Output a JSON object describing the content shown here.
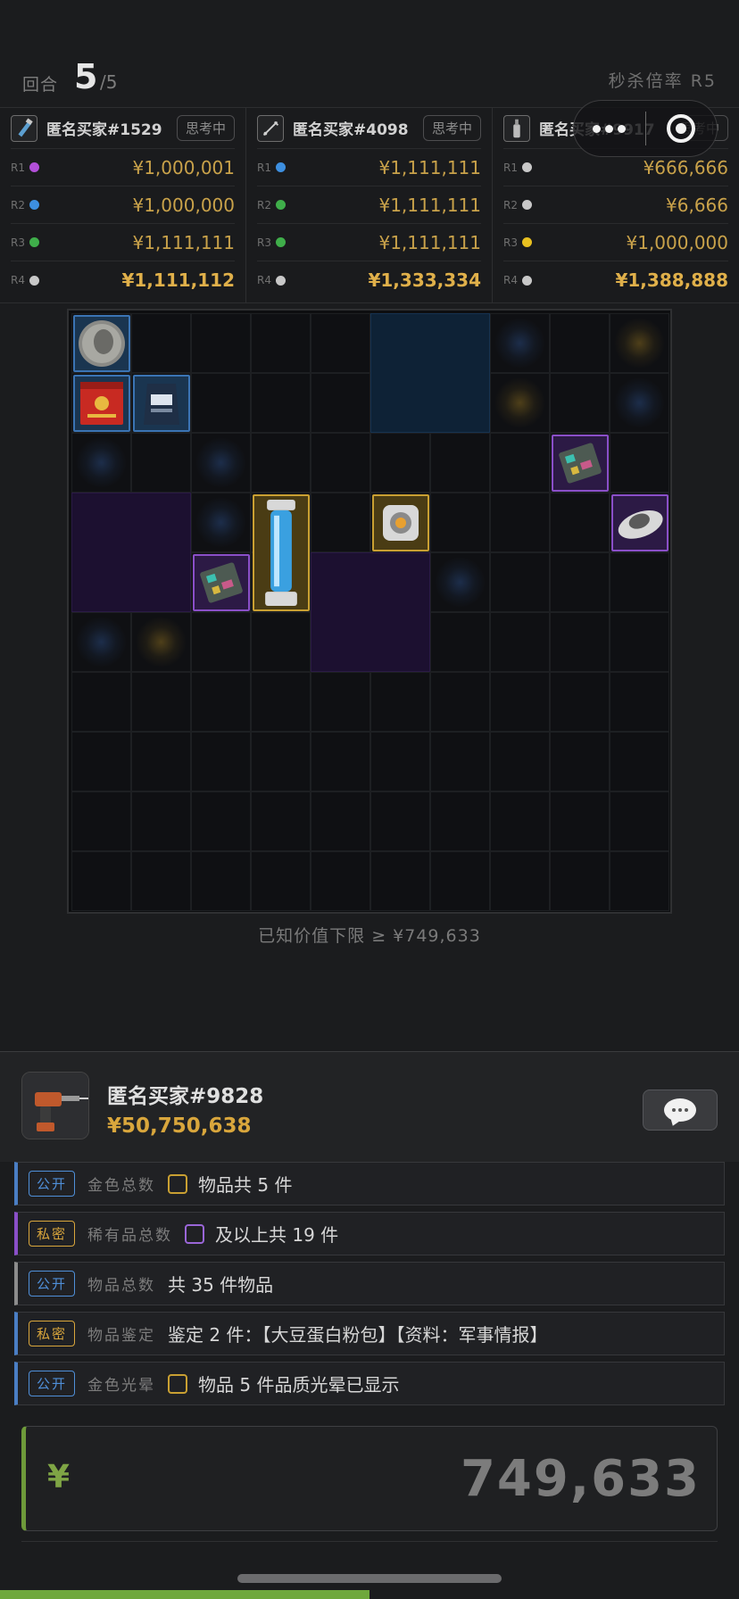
{
  "round": {
    "label": "回合",
    "current": "5",
    "total": "/5"
  },
  "kill_rate": {
    "label": "秒杀倍率 R5"
  },
  "bidders": [
    {
      "name": "匿名买家#1529",
      "status": "思考中",
      "icon": "flashlight-icon",
      "bids": [
        {
          "r": "R1",
          "dot": "#b24fd8",
          "amount": "¥1,000,001"
        },
        {
          "r": "R2",
          "dot": "#3d8fe0",
          "amount": "¥1,000,000"
        },
        {
          "r": "R3",
          "dot": "#3fae4a",
          "amount": "¥1,111,111"
        },
        {
          "r": "R4",
          "dot": "#c8c8c8",
          "amount": "¥1,111,112"
        }
      ]
    },
    {
      "name": "匿名买家#4098",
      "status": "思考中",
      "icon": "tool-icon",
      "bids": [
        {
          "r": "R1",
          "dot": "#3d8fe0",
          "amount": "¥1,111,111"
        },
        {
          "r": "R2",
          "dot": "#3fae4a",
          "amount": "¥1,111,111"
        },
        {
          "r": "R3",
          "dot": "#3fae4a",
          "amount": "¥1,111,111"
        },
        {
          "r": "R4",
          "dot": "#c8c8c8",
          "amount": "¥1,333,334"
        }
      ]
    },
    {
      "name": "匿名买家#9917",
      "status": "思考中",
      "icon": "bottle-icon",
      "bids": [
        {
          "r": "R1",
          "dot": "#c8c8c8",
          "amount": "¥666,666"
        },
        {
          "r": "R2",
          "dot": "#c8c8c8",
          "amount": "¥6,666"
        },
        {
          "r": "R3",
          "dot": "#e8c020",
          "amount": "¥1,000,000"
        },
        {
          "r": "R4",
          "dot": "#c8c8c8",
          "amount": "¥1,388,888"
        }
      ]
    }
  ],
  "grid": {
    "rows": 10,
    "cols": 10,
    "glows": [
      {
        "c": 7,
        "r": 0,
        "color": "blue"
      },
      {
        "c": 9,
        "r": 0,
        "color": "gold"
      },
      {
        "c": 7,
        "r": 1,
        "color": "gold"
      },
      {
        "c": 9,
        "r": 1,
        "color": "blue"
      },
      {
        "c": 0,
        "r": 2,
        "color": "blue"
      },
      {
        "c": 2,
        "r": 2,
        "color": "blue"
      },
      {
        "c": 2,
        "r": 3,
        "color": "blue"
      },
      {
        "c": 6,
        "r": 4,
        "color": "blue"
      },
      {
        "c": 0,
        "r": 5,
        "color": "blue"
      },
      {
        "c": 1,
        "r": 5,
        "color": "gold"
      }
    ],
    "zones": [
      {
        "c": 5,
        "r": 0,
        "w": 2,
        "h": 2,
        "color": "blue"
      },
      {
        "c": 0,
        "r": 3,
        "w": 2,
        "h": 2,
        "color": "purple"
      },
      {
        "c": 4,
        "r": 4,
        "w": 2,
        "h": 2,
        "color": "purple"
      }
    ],
    "items": [
      {
        "name": "coin-item",
        "icon": "coin-icon",
        "c": 0,
        "r": 0,
        "w": 1,
        "h": 1,
        "rarity": "blue"
      },
      {
        "name": "tea-tin-item",
        "icon": "tea-tin-icon",
        "c": 0,
        "r": 1,
        "w": 1,
        "h": 1,
        "rarity": "blue"
      },
      {
        "name": "coffee-bag-item",
        "icon": "coffee-bag-icon",
        "c": 1,
        "r": 1,
        "w": 1,
        "h": 1,
        "rarity": "blue"
      },
      {
        "name": "circuit-board-item",
        "icon": "circuit-board-icon",
        "c": 8,
        "r": 2,
        "w": 1,
        "h": 1,
        "rarity": "purple"
      },
      {
        "name": "liquid-tube-item",
        "icon": "liquid-tube-icon",
        "c": 3,
        "r": 3,
        "w": 1,
        "h": 2,
        "rarity": "gold"
      },
      {
        "name": "cube-item",
        "icon": "cube-icon",
        "c": 5,
        "r": 3,
        "w": 1,
        "h": 1,
        "rarity": "gold"
      },
      {
        "name": "ufo-item",
        "icon": "ufo-icon",
        "c": 9,
        "r": 3,
        "w": 1,
        "h": 1,
        "rarity": "purple"
      },
      {
        "name": "circuit-board-item-2",
        "icon": "circuit-board-icon",
        "c": 2,
        "r": 4,
        "w": 1,
        "h": 1,
        "rarity": "purple"
      }
    ]
  },
  "known_value": "已知价值下限 ≥ ¥749,633",
  "player": {
    "name": "匿名买家#9828",
    "money": "¥50,750,638",
    "avatar": "drill-icon"
  },
  "clues": [
    {
      "tag": "公开",
      "tag_type": "public",
      "type": "金色总数",
      "box": "gold",
      "text": "物品共 5 件",
      "bar": "blue"
    },
    {
      "tag": "私密",
      "tag_type": "private",
      "type": "稀有品总数",
      "box": "purple",
      "text": "及以上共 19 件",
      "bar": "purple"
    },
    {
      "tag": "公开",
      "tag_type": "public",
      "type": "物品总数",
      "box": "",
      "text": "共 35 件物品",
      "bar": "gray"
    },
    {
      "tag": "私密",
      "tag_type": "private",
      "type": "物品鉴定",
      "box": "",
      "text": "鉴定 2 件：【大豆蛋白粉包】【资料：军事情报】",
      "bar": "blue"
    },
    {
      "tag": "公开",
      "tag_type": "public",
      "type": "金色光晕",
      "box": "gold",
      "text": "物品 5 件品质光晕已显示",
      "bar": "blue"
    }
  ],
  "bid_input": {
    "currency": "¥",
    "value": "749,633"
  },
  "progress": {
    "fraction": 0.5
  }
}
